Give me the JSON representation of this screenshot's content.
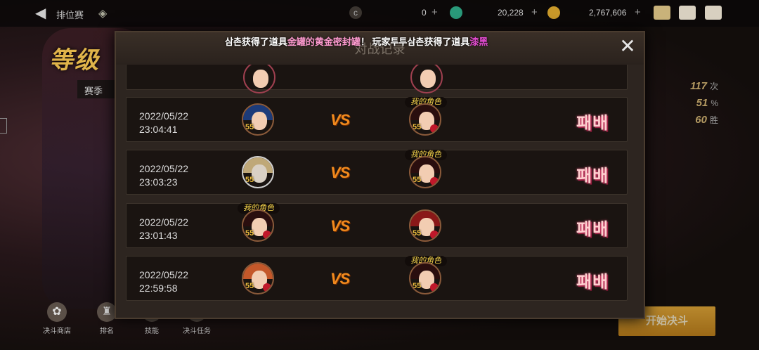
{
  "topbar": {
    "title": "排位赛",
    "currency_a": "0",
    "currency_b": "20,228",
    "currency_c": "2,767,606"
  },
  "stats": [
    {
      "value": "117",
      "unit": "次"
    },
    {
      "value": "51",
      "unit": "%"
    },
    {
      "value": "60",
      "unit": "胜"
    }
  ],
  "announcement": {
    "part1": "삼촌获得了道具",
    "item1": "金罐的黄金密封罐",
    "part2": "！  玩家투투삼촌获得了道具",
    "item2": "漆黑"
  },
  "modal": {
    "title": "对战记录",
    "my_character_tag": "我的角色",
    "vs_label": "VS",
    "rows": [
      {
        "date": "2022/05/22",
        "time": "23:04:41",
        "left_level": "55",
        "right_level": "55",
        "mine": "right",
        "result": "패배"
      },
      {
        "date": "2022/05/22",
        "time": "23:03:23",
        "left_level": "55",
        "right_level": "55",
        "mine": "right",
        "result": "패배"
      },
      {
        "date": "2022/05/22",
        "time": "23:01:43",
        "left_level": "55",
        "right_level": "55",
        "mine": "left",
        "result": "패배"
      },
      {
        "date": "2022/05/22",
        "time": "22:59:58",
        "left_level": "55",
        "right_level": "55",
        "mine": "right",
        "result": "패배"
      }
    ]
  },
  "bottom_nav": [
    {
      "label": "决斗商店",
      "icon": "shop-icon"
    },
    {
      "label": "排名",
      "icon": "trophy-icon"
    },
    {
      "label": "技能",
      "icon": "skill-icon"
    },
    {
      "label": "决斗任务",
      "icon": "quest-icon"
    }
  ],
  "start_button": "开始决斗",
  "colors": {
    "accent": "#f08a1e",
    "result": "#ffd0d0",
    "gold": "#f4d34a"
  }
}
